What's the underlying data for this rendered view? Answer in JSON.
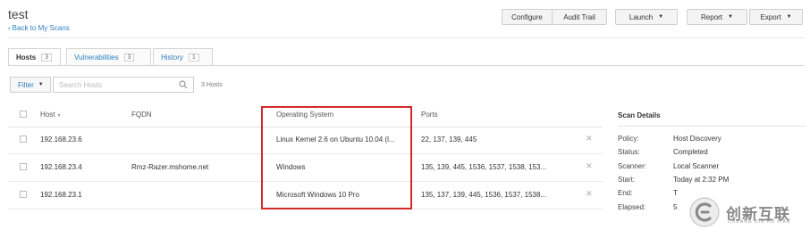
{
  "header": {
    "title": "test",
    "back_link": "Back to My Scans"
  },
  "toolbar": {
    "configure": "Configure",
    "audit_trail": "Audit Trail",
    "launch": "Launch",
    "report": "Report",
    "export": "Export"
  },
  "tabs": [
    {
      "label": "Hosts",
      "count": "3"
    },
    {
      "label": "Vulnerabilities",
      "count": "3"
    },
    {
      "label": "History",
      "count": "1"
    }
  ],
  "filter": {
    "label": "Filter",
    "search_placeholder": "Search Hosts",
    "count_text": "3 Hosts"
  },
  "table": {
    "columns": [
      "Host",
      "FQDN",
      "Operating System",
      "Ports"
    ],
    "rows": [
      {
        "host": "192.168.23.6",
        "fqdn": "",
        "os": "Linux Kernel 2.6 on Ubuntu 10.04 (l...",
        "ports": "22, 137, 139, 445"
      },
      {
        "host": "192.168.23.4",
        "fqdn": "Rmz-Razer.mshome.net",
        "os": "Windows",
        "ports": "135, 139, 445, 1536, 1537, 1538, 153..."
      },
      {
        "host": "192.168.23.1",
        "fqdn": "",
        "os": "Microsoft Windows 10 Pro",
        "ports": "135, 137, 139, 445, 1536, 1537, 1538..."
      }
    ]
  },
  "scan_details": {
    "title": "Scan Details",
    "items": [
      {
        "key": "Policy:",
        "value": "Host Discovery"
      },
      {
        "key": "Status:",
        "value": "Completed"
      },
      {
        "key": "Scanner:",
        "value": "Local Scanner"
      },
      {
        "key": "Start:",
        "value": "Today at 2:32 PM"
      },
      {
        "key": "End:",
        "value": "T"
      },
      {
        "key": "Elapsed:",
        "value": "5"
      }
    ]
  },
  "watermark": {
    "text": "创新互联",
    "sub": "CHUANG XIN HU LIAN"
  },
  "colors": {
    "accent": "#2d7fc1",
    "highlight_box": "#d32a2a"
  }
}
